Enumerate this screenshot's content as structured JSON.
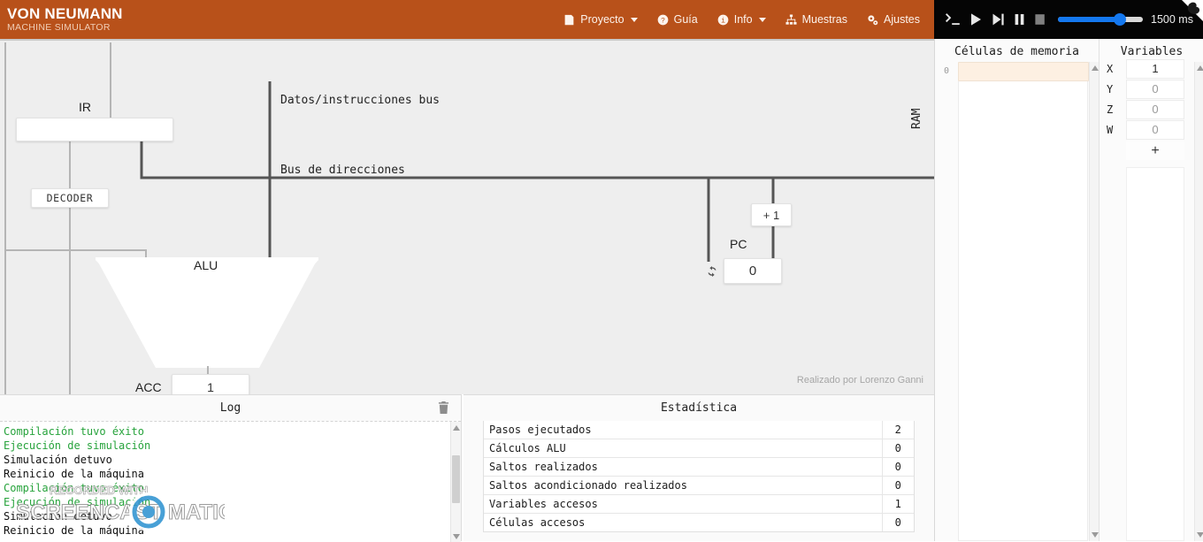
{
  "brand": {
    "line1": "VON NEUMANN",
    "line2": "MACHINE SIMULATOR"
  },
  "nav": [
    {
      "label": "Proyecto",
      "icon": "file-icon",
      "caret": true
    },
    {
      "label": "Guía",
      "icon": "help-circle-icon",
      "caret": false
    },
    {
      "label": "Info",
      "icon": "info-circle-icon",
      "caret": true
    },
    {
      "label": "Muestras",
      "icon": "sitemap-icon",
      "caret": false
    },
    {
      "label": "Ajustes",
      "icon": "gears-icon",
      "caret": false
    }
  ],
  "player": {
    "terminal_icon": "terminal-icon",
    "play_icon": "play-icon",
    "step_icon": "step-forward-icon",
    "pause_icon": "pause-icon",
    "stop_icon": "stop-icon",
    "speed_label": "1500 ms",
    "speed_percent": 73
  },
  "diagram": {
    "ir_label": "IR",
    "ir_value": "",
    "decoder_label": "DECODER",
    "alu_label": "ALU",
    "acc_label": "ACC",
    "acc_value": "1",
    "plus_one_label": "+ 1",
    "pc_label": "PC",
    "pc_value": "0",
    "pc_reset_icon": "refresh-icon",
    "data_bus_label": "Datos/instrucciones bus",
    "address_bus_label": "Bus de direcciones",
    "ram_label": "RAM",
    "credit": "Realizado por Lorenzo Ganni"
  },
  "log": {
    "title": "Log",
    "clear_icon": "trash-icon",
    "entries": [
      {
        "text": "Compilación tuvo éxito",
        "type": "ok"
      },
      {
        "text": "Ejecución de simulación",
        "type": "ok"
      },
      {
        "text": "Simulación detuvo",
        "type": "info"
      },
      {
        "text": "Reinicio de la máquina",
        "type": "info"
      },
      {
        "text": "Compilación tuvo éxito",
        "type": "ok"
      },
      {
        "text": "Ejecución de simulación",
        "type": "ok"
      },
      {
        "text": "Simulación detuvo",
        "type": "info"
      },
      {
        "text": "Reinicio de la máquina",
        "type": "info"
      }
    ]
  },
  "stats": {
    "title": "Estadística",
    "rows": [
      {
        "label": "Pasos ejecutados",
        "value": "2"
      },
      {
        "label": "Cálculos ALU",
        "value": "0"
      },
      {
        "label": "Saltos realizados",
        "value": "0"
      },
      {
        "label": "Saltos acondicionado realizados",
        "value": "0"
      },
      {
        "label": "Variables accesos",
        "value": "1"
      },
      {
        "label": "Células accesos",
        "value": "0"
      }
    ]
  },
  "memory": {
    "title": "Células de memoria",
    "cells": [
      {
        "index": "0",
        "value": ""
      }
    ]
  },
  "variables": {
    "title": "Variables",
    "add_label": "+",
    "items": [
      {
        "name": "X",
        "value": "1",
        "active": true
      },
      {
        "name": "Y",
        "value": "0",
        "active": false
      },
      {
        "name": "Z",
        "value": "0",
        "active": false
      },
      {
        "name": "W",
        "value": "0",
        "active": false
      }
    ]
  },
  "watermark": {
    "line1": "RECORDED WITH",
    "line2a": "SCREENCAST",
    "line2b": "MATIC"
  },
  "colors": {
    "brand": "#b8511a",
    "accent": "#1478ef",
    "log_ok": "#27a33c",
    "cell_highlight": "#fdf0e2"
  }
}
